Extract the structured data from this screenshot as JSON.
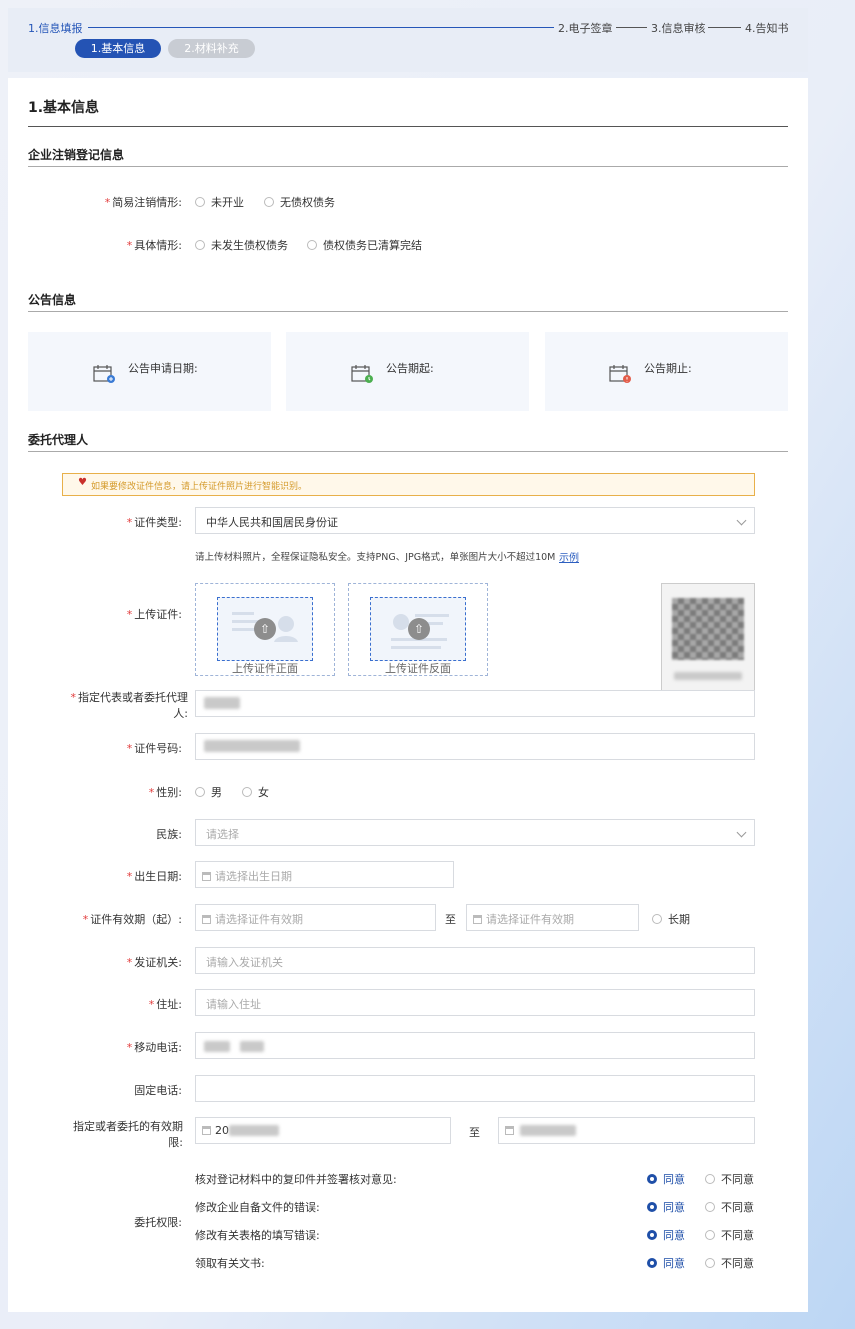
{
  "steps": [
    {
      "label": "1.信息填报"
    },
    {
      "label": "2.电子签章"
    },
    {
      "label": "3.信息审核"
    },
    {
      "label": "4.告知书"
    }
  ],
  "substeps": [
    {
      "label": "1.基本信息"
    },
    {
      "label": "2.材料补充"
    }
  ],
  "page_title": "1.基本信息",
  "section_cancel": {
    "title": "企业注销登记信息",
    "row1": {
      "label": "简易注销情形:",
      "options": [
        "未开业",
        "无债权债务"
      ]
    },
    "row2": {
      "label": "具体情形:",
      "options": [
        "未发生债权债务",
        "债权债务已清算完结"
      ]
    }
  },
  "section_notice": {
    "title": "公告信息",
    "boxes": [
      {
        "label": "公告申请日期:",
        "icon": "calendar-add-icon"
      },
      {
        "label": "公告期起:",
        "icon": "calendar-start-icon"
      },
      {
        "label": "公告期止:",
        "icon": "calendar-end-icon"
      }
    ]
  },
  "section_agent": {
    "title": "委托代理人",
    "warning": "如果要修改证件信息，请上传证件照片进行智能识别。",
    "id_type": {
      "label": "证件类型:",
      "value": "中华人民共和国居民身份证"
    },
    "upload_hint": "请上传材料照片，全程保证隐私安全。支持PNG、JPG格式，单张图片大小不超过10M",
    "upload_example": "示例",
    "upload": {
      "label": "上传证件:",
      "front": "上传证件正面",
      "back": "上传证件反面"
    },
    "agent_name": {
      "label": "指定代表或者委托代理人:"
    },
    "id_number": {
      "label": "证件号码:"
    },
    "gender": {
      "label": "性别:",
      "options": [
        "男",
        "女"
      ]
    },
    "ethnicity": {
      "label": "民族:",
      "placeholder": "请选择"
    },
    "birth": {
      "label": "出生日期:",
      "placeholder": "请选择出生日期"
    },
    "validity": {
      "label": "证件有效期（起）:",
      "start_placeholder": "请选择证件有效期",
      "to": "至",
      "end_placeholder": "请选择证件有效期",
      "long_term": "长期"
    },
    "issuer": {
      "label": "发证机关:",
      "placeholder": "请输入发证机关"
    },
    "address": {
      "label": "住址:",
      "placeholder": "请输入住址"
    },
    "mobile": {
      "label": "移动电话:"
    },
    "landline": {
      "label": "固定电话:"
    },
    "period": {
      "label": "指定或者委托的有效期限:",
      "start_value": "20",
      "to": "至"
    },
    "permissions": {
      "label": "委托权限:",
      "agree": "同意",
      "disagree": "不同意",
      "items": [
        "核对登记材料中的复印件并签署核对意见:",
        "修改企业自备文件的错误:",
        "修改有关表格的填写错误:",
        "领取有关文书:"
      ]
    }
  },
  "colors": {
    "accent": "#2453b4",
    "required": "#e23b3b",
    "warning_border": "#e8b04a"
  }
}
